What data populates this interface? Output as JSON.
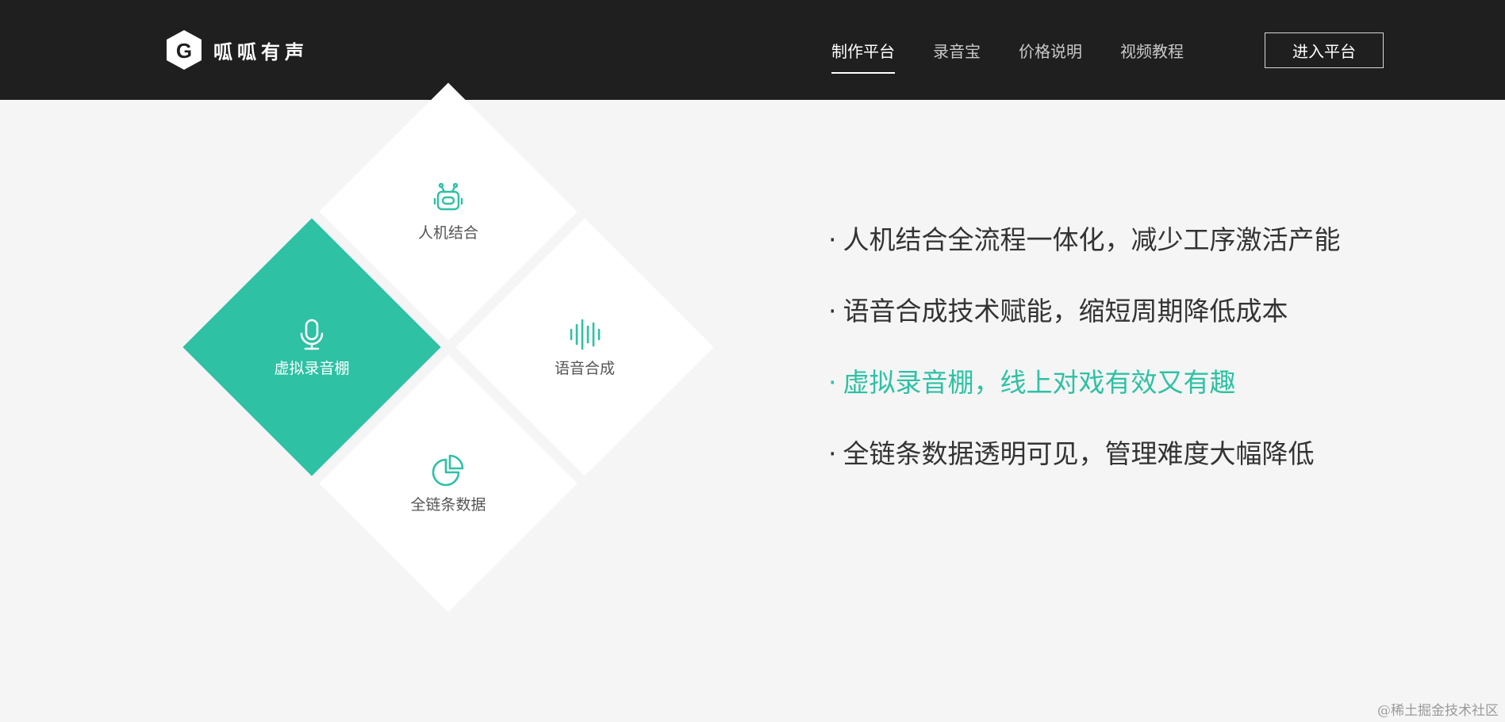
{
  "brand": {
    "logo_letter": "G",
    "name": "呱呱有声"
  },
  "nav": {
    "items": [
      {
        "label": "制作平台",
        "active": true
      },
      {
        "label": "录音宝",
        "active": false
      },
      {
        "label": "价格说明",
        "active": false
      },
      {
        "label": "视频教程",
        "active": false
      }
    ],
    "cta_label": "进入平台"
  },
  "diamonds": [
    {
      "label": "人机结合",
      "icon": "robot-icon",
      "active": false
    },
    {
      "label": "虚拟录音棚",
      "icon": "microphone-icon",
      "active": true
    },
    {
      "label": "语音合成",
      "icon": "sound-wave-icon",
      "active": false
    },
    {
      "label": "全链条数据",
      "icon": "pie-chart-icon",
      "active": false
    }
  ],
  "features": [
    {
      "bullet": "·",
      "text": "人机结合全流程一体化，减少工序激活产能",
      "highlight": false
    },
    {
      "bullet": "·",
      "text": "语音合成技术赋能，缩短周期降低成本",
      "highlight": false
    },
    {
      "bullet": "·",
      "text": "虚拟录音棚，线上对戏有效又有趣",
      "highlight": true
    },
    {
      "bullet": "·",
      "text": "全链条数据透明可见，管理难度大幅降低",
      "highlight": false
    }
  ],
  "watermark": "@稀土掘金技术社区",
  "colors": {
    "header_bg": "#1f1f20",
    "accent": "#2ec1a4",
    "page_bg": "#f5f5f5"
  }
}
